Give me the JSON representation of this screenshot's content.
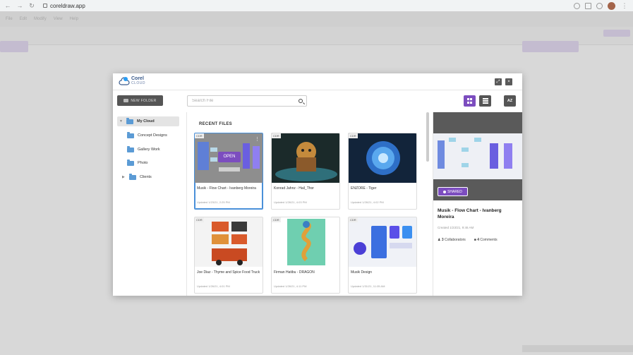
{
  "browser": {
    "url": "coreldraw.app"
  },
  "app_menu": [
    "File",
    "Edit",
    "Modify",
    "View",
    "Help"
  ],
  "modal": {
    "logo": {
      "brand": "Corel",
      "product": "CLOUD"
    },
    "new_folder_label": "NEW FOLDER",
    "search_placeholder": "Search File",
    "sort_label": "AZ"
  },
  "sidebar": {
    "root": "My Cloud",
    "items": [
      {
        "label": "Concept Designs"
      },
      {
        "label": "Gallery Work"
      },
      {
        "label": "Photo"
      },
      {
        "label": "Clients"
      }
    ]
  },
  "recent": {
    "title": "RECENT FILES",
    "open_label": "OPEN",
    "files": [
      {
        "tag": "CDR",
        "name": "Musik - Flow Chart - Ivanberg Moreira",
        "date": "Updated 1/23/21, 2:25 PM",
        "selected": true
      },
      {
        "tag": "CDR",
        "name": "Konrad Jahnz - Hail_Thor",
        "date": "Updated 1/26/21, 4:03 PM"
      },
      {
        "tag": "CDR",
        "name": "ENZORE - Tiger",
        "date": "Updated 1/26/21, 4:02 PM"
      },
      {
        "tag": "CDR",
        "name": "Joe Diaz - Thyme and Spice Food Truck",
        "date": "Updated 1/26/21, 4:01 PM"
      },
      {
        "tag": "CDR",
        "name": "Firman Hatibu - DRAGON",
        "date": "Updated 1/26/21, 4:11 PM"
      },
      {
        "tag": "CDR",
        "name": "Musik Design",
        "date": "Updated 1/31/21, 11:05 AM"
      }
    ]
  },
  "detail": {
    "shared_label": "SHARED",
    "name": "Musik - Flow Chart - Ivanberg Moreira",
    "date": "Created 1/23/21, 9:46 AM",
    "collaborators_count": "3",
    "collaborators_label": "Collaborators",
    "comments_count": "4",
    "comments_label": "Comments"
  },
  "colors": {
    "accent": "#7c4dbf",
    "folder": "#5b9bd5",
    "selection": "#4a90d9"
  }
}
